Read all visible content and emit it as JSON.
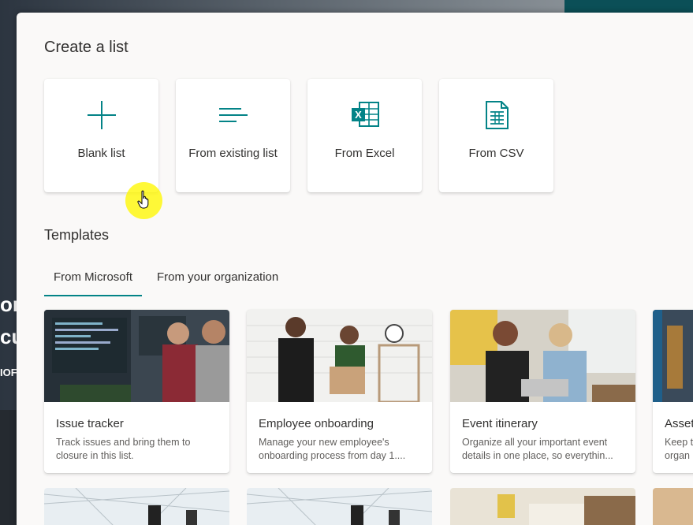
{
  "create": {
    "title": "Create a list",
    "cards": [
      {
        "label": "Blank list",
        "icon": "plus-icon"
      },
      {
        "label": "From existing list",
        "icon": "list-lines-icon"
      },
      {
        "label": "From Excel",
        "icon": "excel-icon"
      },
      {
        "label": "From CSV",
        "icon": "csv-file-icon"
      }
    ]
  },
  "templates": {
    "title": "Templates",
    "tabs": [
      {
        "label": "From Microsoft",
        "active": true
      },
      {
        "label": "From your organization",
        "active": false
      }
    ],
    "cards": [
      {
        "title": "Issue tracker",
        "description": "Track issues and bring them to closure in this list."
      },
      {
        "title": "Employee onboarding",
        "description": "Manage your new employee's onboarding process from day 1...."
      },
      {
        "title": "Event itinerary",
        "description": "Organize all your important event details in one place, so everythin..."
      },
      {
        "title": "Asset",
        "description": "Keep t organ"
      }
    ]
  },
  "background": {
    "text_fragments": [
      "or",
      "cu",
      "IOF"
    ]
  },
  "colors": {
    "accent": "#038387",
    "excel_green": "#107c41"
  }
}
